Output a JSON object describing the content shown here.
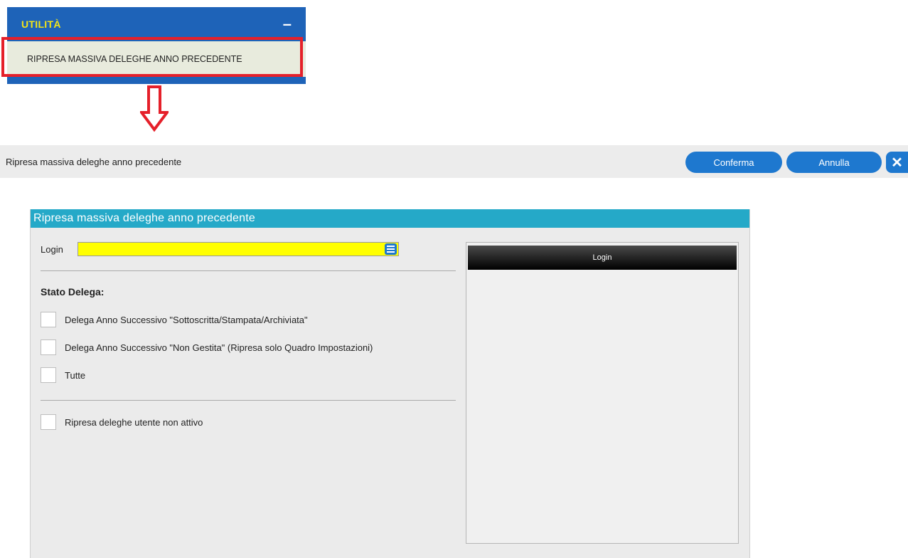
{
  "menu": {
    "title": "UTILITÀ",
    "collapse_symbol": "–",
    "item_label": "RIPRESA MASSIVA DELEGHE ANNO PRECEDENTE",
    "highlight_color": "#e5202a"
  },
  "toolbar": {
    "title": "Ripresa massiva deleghe anno precedente",
    "confirm_label": "Conferma",
    "cancel_label": "Annulla",
    "close_symbol": "✕"
  },
  "dialog": {
    "title": "Ripresa massiva deleghe anno precedente",
    "login_label": "Login",
    "login_value": "",
    "section_title": "Stato Delega:",
    "options": [
      {
        "label": "Delega Anno Successivo \"Sottoscritta/Stampata/Archiviata\"",
        "checked": false
      },
      {
        "label": "Delega Anno Successivo \"Non Gestita\" (Ripresa solo Quadro Impostazioni)",
        "checked": false
      },
      {
        "label": "Tutte",
        "checked": false
      }
    ],
    "inactive_user_option": {
      "label": "Ripresa deleghe utente non attivo",
      "checked": false
    },
    "side_panel_header": "Login"
  },
  "colors": {
    "menu_blue": "#1e63b8",
    "menu_title_yellow": "#f3e418",
    "button_blue": "#1e78cf",
    "dialog_header_teal": "#25a9c8",
    "login_field_yellow": "#ffff00"
  },
  "icons": {
    "arrow": "down-arrow-icon",
    "close": "close-icon",
    "list": "list-icon"
  }
}
